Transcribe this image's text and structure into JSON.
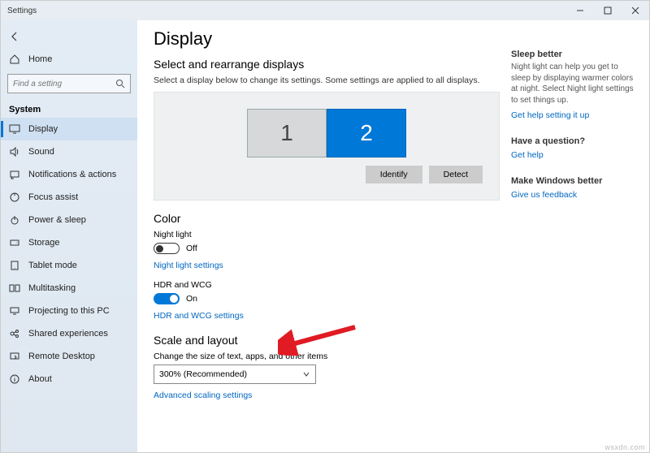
{
  "titlebar": {
    "title": "Settings"
  },
  "sidebar": {
    "back": "",
    "home": "Home",
    "search_placeholder": "Find a setting",
    "heading": "System",
    "items": [
      {
        "label": "Display"
      },
      {
        "label": "Sound"
      },
      {
        "label": "Notifications & actions"
      },
      {
        "label": "Focus assist"
      },
      {
        "label": "Power & sleep"
      },
      {
        "label": "Storage"
      },
      {
        "label": "Tablet mode"
      },
      {
        "label": "Multitasking"
      },
      {
        "label": "Projecting to this PC"
      },
      {
        "label": "Shared experiences"
      },
      {
        "label": "Remote Desktop"
      },
      {
        "label": "About"
      }
    ]
  },
  "main": {
    "title": "Display",
    "rearrange_heading": "Select and rearrange displays",
    "rearrange_desc": "Select a display below to change its settings. Some settings are applied to all displays.",
    "monitor1": "1",
    "monitor2": "2",
    "identify": "Identify",
    "detect": "Detect",
    "color_heading": "Color",
    "night_light_label": "Night light",
    "night_light_state": "Off",
    "night_light_link": "Night light settings",
    "hdr_label": "HDR and WCG",
    "hdr_state": "On",
    "hdr_link": "HDR and WCG settings",
    "scale_heading": "Scale and layout",
    "scale_label": "Change the size of text, apps, and other items",
    "scale_value": "300% (Recommended)",
    "advanced_scaling": "Advanced scaling settings"
  },
  "right": {
    "sleep_heading": "Sleep better",
    "sleep_desc": "Night light can help you get to sleep by displaying warmer colors at night. Select Night light settings to set things up.",
    "sleep_link": "Get help setting it up",
    "question_heading": "Have a question?",
    "question_link": "Get help",
    "feedback_heading": "Make Windows better",
    "feedback_link": "Give us feedback"
  },
  "watermark": "wsxdn.com"
}
